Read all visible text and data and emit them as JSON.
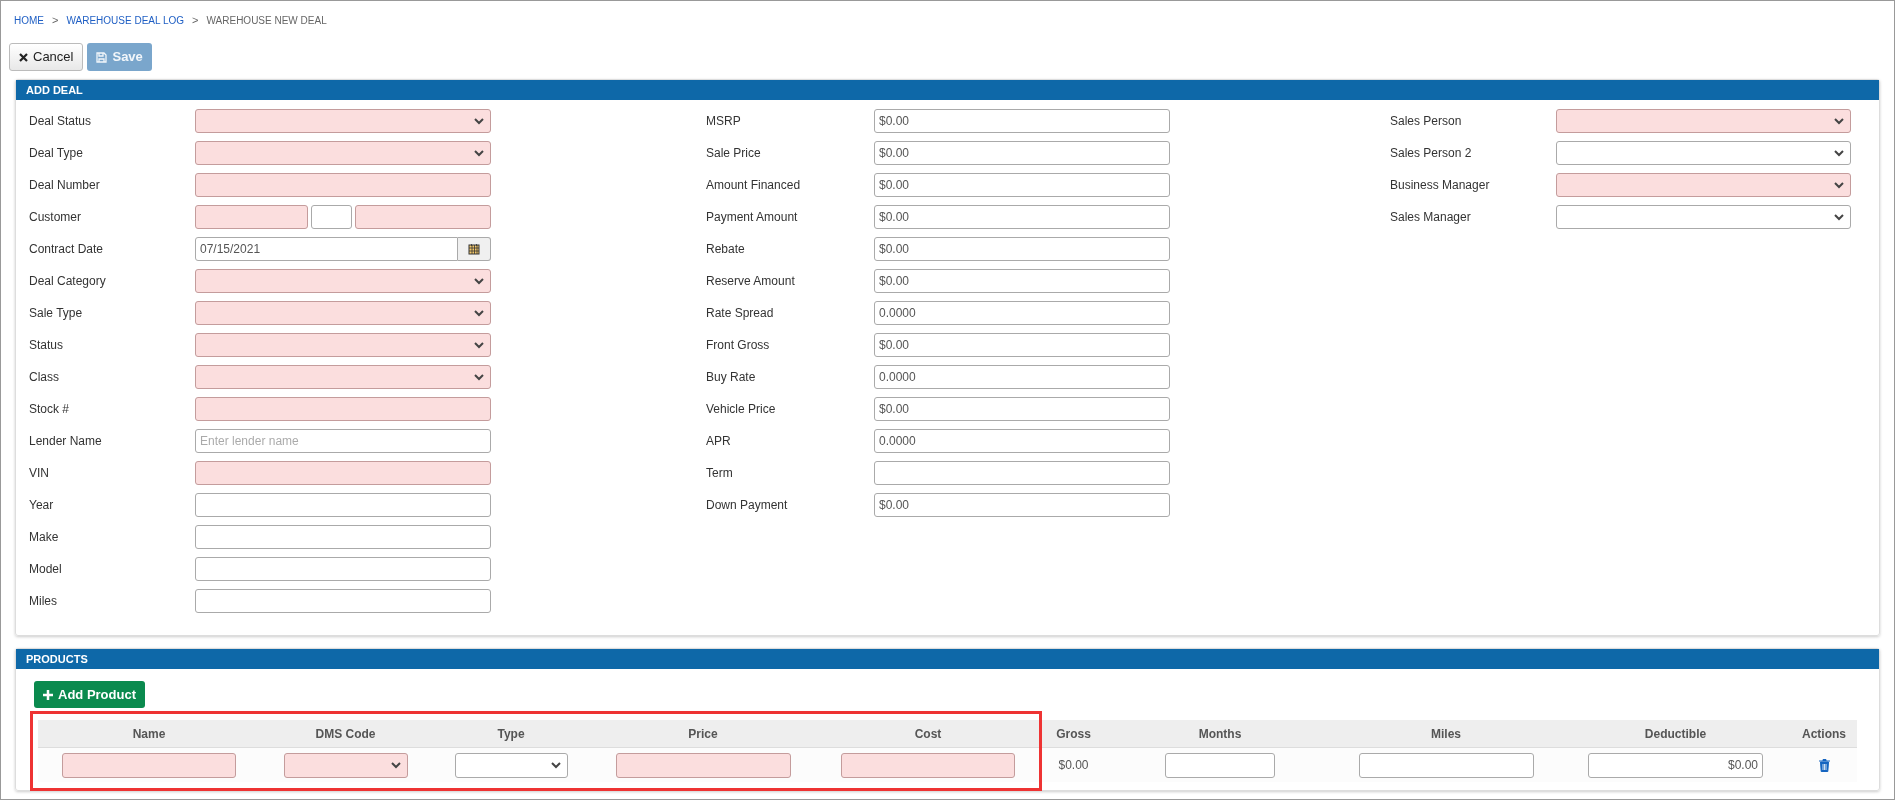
{
  "breadcrumb": [
    {
      "label": "HOME",
      "link": true
    },
    {
      "label": "WAREHOUSE DEAL LOG",
      "link": true
    },
    {
      "label": "WAREHOUSE NEW DEAL",
      "link": false
    }
  ],
  "breadcrumb_separator": ">",
  "toolbar": [
    {
      "label": "Cancel",
      "kind": "cancel",
      "disabled": false
    },
    {
      "label": "Save",
      "kind": "save",
      "disabled": true
    }
  ],
  "add_deal": {
    "title": "ADD DEAL",
    "columns": [
      [
        {
          "label": "Deal Status",
          "kind": "select",
          "required": true
        },
        {
          "label": "Deal Type",
          "kind": "select",
          "required": true
        },
        {
          "label": "Deal Number",
          "kind": "text",
          "required": true
        },
        {
          "label": "Customer",
          "kind": "name-parts",
          "required": true
        },
        {
          "label": "Contract Date",
          "kind": "date",
          "required": false,
          "value": "07/15/2021"
        },
        {
          "label": "Deal Category",
          "kind": "select",
          "required": true
        },
        {
          "label": "Sale Type",
          "kind": "select",
          "required": true
        },
        {
          "label": "Status",
          "kind": "select",
          "required": true
        },
        {
          "label": "Class",
          "kind": "select",
          "required": true
        },
        {
          "label": "Stock #",
          "kind": "text",
          "required": true
        },
        {
          "label": "Lender Name",
          "kind": "text",
          "required": false,
          "placeholder": "Enter lender name"
        },
        {
          "label": "VIN",
          "kind": "text",
          "required": true
        },
        {
          "label": "Year",
          "kind": "text",
          "required": false
        },
        {
          "label": "Make",
          "kind": "text",
          "required": false
        },
        {
          "label": "Model",
          "kind": "text",
          "required": false
        },
        {
          "label": "Miles",
          "kind": "text",
          "required": false
        }
      ],
      [
        {
          "label": "MSRP",
          "kind": "text",
          "required": false,
          "value": "$0.00"
        },
        {
          "label": "Sale Price",
          "kind": "text",
          "required": false,
          "value": "$0.00"
        },
        {
          "label": "Amount Financed",
          "kind": "text",
          "required": false,
          "value": "$0.00"
        },
        {
          "label": "Payment Amount",
          "kind": "text",
          "required": false,
          "value": "$0.00"
        },
        {
          "label": "Rebate",
          "kind": "text",
          "required": false,
          "value": "$0.00"
        },
        {
          "label": "Reserve Amount",
          "kind": "text",
          "required": false,
          "value": "$0.00"
        },
        {
          "label": "Rate Spread",
          "kind": "text",
          "required": false,
          "value": "0.0000"
        },
        {
          "label": "Front Gross",
          "kind": "text",
          "required": false,
          "value": "$0.00"
        },
        {
          "label": "Buy Rate",
          "kind": "text",
          "required": false,
          "value": "0.0000"
        },
        {
          "label": "Vehicle Price",
          "kind": "text",
          "required": false,
          "value": "$0.00"
        },
        {
          "label": "APR",
          "kind": "text",
          "required": false,
          "value": "0.0000"
        },
        {
          "label": "Term",
          "kind": "text",
          "required": false
        },
        {
          "label": "Down Payment",
          "kind": "text",
          "required": false,
          "value": "$0.00"
        }
      ],
      [
        {
          "label": "Sales Person",
          "kind": "select",
          "required": true
        },
        {
          "label": "Sales Person 2",
          "kind": "select",
          "required": false
        },
        {
          "label": "Business Manager",
          "kind": "select",
          "required": true
        },
        {
          "label": "Sales Manager",
          "kind": "select",
          "required": false
        }
      ]
    ]
  },
  "products": {
    "title": "PRODUCTS",
    "add_button": "Add Product",
    "columns": [
      {
        "label": "Name",
        "kind": "text",
        "required": true
      },
      {
        "label": "DMS Code",
        "kind": "select",
        "required": true
      },
      {
        "label": "Type",
        "kind": "select",
        "required": false
      },
      {
        "label": "Price",
        "kind": "text",
        "required": true
      },
      {
        "label": "Cost",
        "kind": "text",
        "required": true
      },
      {
        "label": "Gross",
        "kind": "static",
        "value": "$0.00"
      },
      {
        "label": "Months",
        "kind": "text",
        "required": false
      },
      {
        "label": "Miles",
        "kind": "text",
        "required": false
      },
      {
        "label": "Deductible",
        "kind": "text",
        "required": false,
        "value": "$0.00"
      },
      {
        "label": "Actions",
        "kind": "delete"
      }
    ]
  }
}
